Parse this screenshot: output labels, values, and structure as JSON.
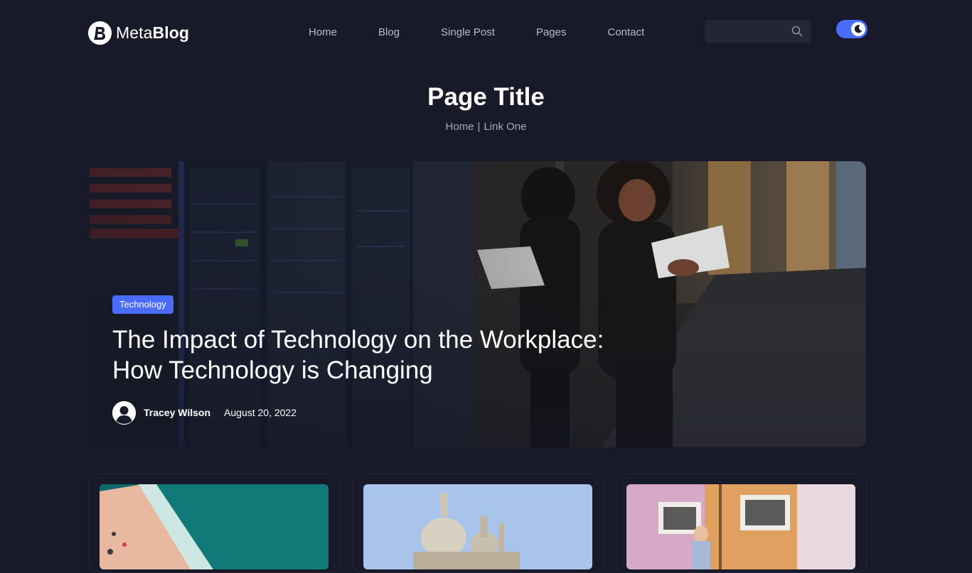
{
  "header": {
    "logo": {
      "text_light": "Meta",
      "text_bold": "Blog"
    },
    "nav": [
      "Home",
      "Blog",
      "Single Post",
      "Pages",
      "Contact"
    ],
    "search": {
      "placeholder": "",
      "icon": "search-icon"
    },
    "theme_toggle": {
      "state": "dark",
      "icon": "moon-icon",
      "color": "#4b6bfb"
    }
  },
  "page": {
    "title": "Page Title",
    "breadcrumb": {
      "home": "Home",
      "separator": "|",
      "current": "Link One"
    }
  },
  "hero": {
    "tag": "Technology",
    "title": "The Impact of Technology on the Workplace: How Technology is Changing",
    "author": "Tracey Wilson",
    "date": "August 20, 2022"
  },
  "cards": [
    {
      "image": "beach-aerial-image"
    },
    {
      "image": "cathedral-dome-image"
    },
    {
      "image": "city-street-image"
    }
  ],
  "colors": {
    "background": "#181a2a",
    "accent": "#4b6bfb",
    "muted_text": "#babbc6"
  }
}
